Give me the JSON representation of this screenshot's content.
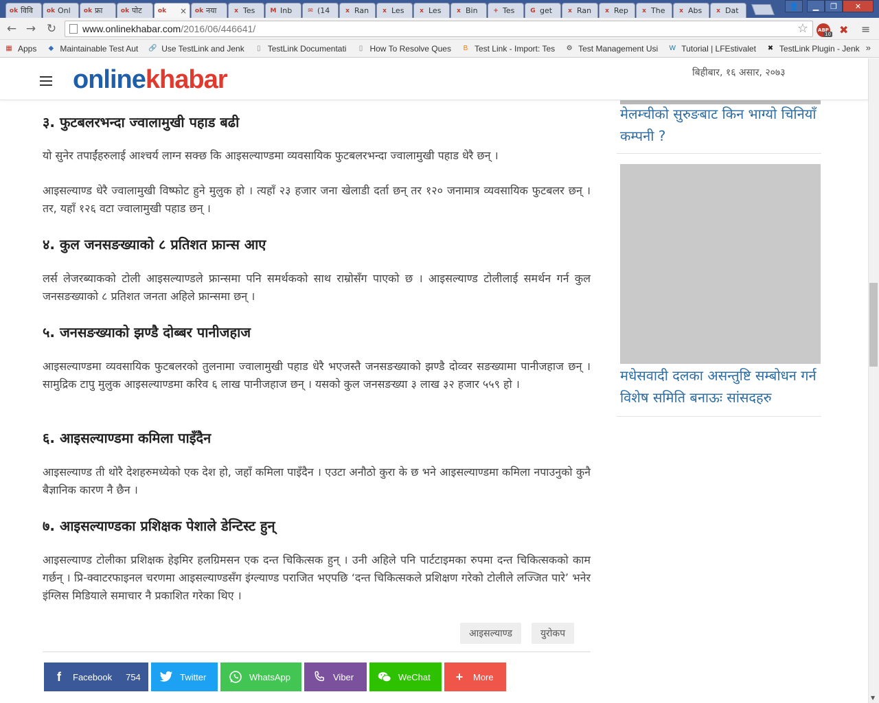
{
  "browser": {
    "tabs": [
      {
        "favicon": "ok",
        "title": "विवि"
      },
      {
        "favicon": "ok",
        "title": "Onl"
      },
      {
        "favicon": "ok",
        "title": "फ्रा"
      },
      {
        "favicon": "ok",
        "title": "पोट"
      },
      {
        "favicon": "ok",
        "title": "",
        "active": true
      },
      {
        "favicon": "ok",
        "title": "नया"
      },
      {
        "favicon": "x",
        "title": "Tes"
      },
      {
        "favicon": "M",
        "title": "Inb"
      },
      {
        "favicon": "✉",
        "title": "(14"
      },
      {
        "favicon": "x",
        "title": "Ran"
      },
      {
        "favicon": "x",
        "title": "Les"
      },
      {
        "favicon": "x",
        "title": "Les"
      },
      {
        "favicon": "x",
        "title": "Bin"
      },
      {
        "favicon": "+",
        "title": "Tes"
      },
      {
        "favicon": "G",
        "title": "get"
      },
      {
        "favicon": "x",
        "title": "Ran"
      },
      {
        "favicon": "x",
        "title": "Rep"
      },
      {
        "favicon": "x",
        "title": "The"
      },
      {
        "favicon": "x",
        "title": "Abs"
      },
      {
        "favicon": "x",
        "title": "Dat"
      }
    ],
    "url_host": "www.onlinekhabar.com",
    "url_path": "/2016/06/446641/",
    "abp_label": "ABP",
    "abp_count": "10",
    "bookmarks": [
      {
        "icon": "apps-grid",
        "label": "Apps"
      },
      {
        "icon": "testlink",
        "label": "Maintainable Test Aut"
      },
      {
        "icon": "link",
        "label": "Use TestLink and Jenk"
      },
      {
        "icon": "page",
        "label": "TestLink Documentati"
      },
      {
        "icon": "page",
        "label": "How To Resolve Ques"
      },
      {
        "icon": "blogger",
        "label": "Test Link - Import: Tes"
      },
      {
        "icon": "tool",
        "label": "Test Management Usi"
      },
      {
        "icon": "wordpress",
        "label": "Tutorial | LFEstivalet"
      },
      {
        "icon": "plugin",
        "label": "TestLink Plugin - Jenk"
      }
    ],
    "bookmarks_more": "»"
  },
  "site": {
    "logo_part1": "online",
    "logo_part2": "khabar",
    "date": "बिहीबार, १६ असार, २०७३"
  },
  "article": {
    "sections": [
      {
        "heading": "३. फुटबलरभन्दा ज्वालामुखी पहाड बढी",
        "paragraphs": [
          "यो सुनेर तपाईंहरुलाई आश्चर्य लाग्न सक्छ कि आइसल्याण्डमा व्यवसायिक फुटबलरभन्दा ज्वालामुखी पहाड धेरै छन् ।",
          "आइसल्याण्ड धेरै ज्वालामुखी विष्फोट हुने मुलुक हो । त्यहाँ २३ हजार जना खेलाडी दर्ता छन् तर १२० जनामात्र व्यवसायिक फुटबलर छन् । तर, यहाँ १२६ वटा ज्वालामुखी पहाड छन् ।"
        ]
      },
      {
        "heading": "४. कुल जनसङख्याको ८ प्रतिशत फ्रान्स आए",
        "paragraphs": [
          "लर्स लेजरब्याकको टोली आइसल्याण्डले फ्रान्समा पनि समर्थकको साथ राम्रोसँग पाएको छ । आइसल्याण्ड टोलीलाई समर्थन गर्न कुल जनसङख्याको ८ प्रतिशत जनता अहिले फ्रान्समा छन् ।"
        ]
      },
      {
        "heading": "५. जनसङख्याको झण्डै दोब्बर पानीजहाज",
        "paragraphs": [
          "आइसल्याण्डमा व्यवसायिक फुटबलरको तुलनामा ज्वालामुखी पहाड धेरै भएजस्तै जनसङख्याको झण्डै दोव्वर सङख्यामा पानीजहाज छन् । सामुद्रिक टापु मुलुक आइसल्याण्डमा करिव ६ लाख पानीजहाज छन् । यसको कुल जनसङख्या ३ लाख ३२ हजार ५५९ हो ।"
        ]
      },
      {
        "heading": "६. आइसल्याण्डमा कमिला पाइँदैन",
        "paragraphs": [
          "आइसल्याण्ड ती थोरै देशहरुमध्येको एक देश हो, जहाँ कमिला पाइँदैन । एउटा अनौठो कुरा के छ भने आइसल्याण्डमा कमिला नपाउनुको कुनै बैज्ञानिक कारण नै छैन ।"
        ]
      },
      {
        "heading": "७. आइसल्याण्डका प्रशिक्षक पेशाले डेन्टिस्ट हुन्",
        "paragraphs": [
          "आइसल्याण्ड टोलीका प्रशिक्षक हेइमिर हलग्रिमसन एक दन्त चिकित्सक हुन् । उनी अहिले पनि पार्टटाइमका रुपमा दन्त चिकित्सकको काम गर्छन् । प्रि-क्वाटरफाइनल चरणमा आइसल्याण्डसँग इंग्ल्याण्ड पराजित भएपछि ‘दन्त चिकित्सकले प्रशिक्षण गरेको टोलीले लज्जित पारे’ भनेर इंग्लिस मिडियाले समाचार नै प्रकाशित गरेका थिए ।"
        ]
      }
    ],
    "tags": [
      "आइसल्याण्ड",
      "युरोकप"
    ]
  },
  "share": {
    "facebook": {
      "label": "Facebook",
      "count": "754",
      "color": "#3b5998"
    },
    "twitter": {
      "label": "Twitter",
      "color": "#1da1f2"
    },
    "whatsapp": {
      "label": "WhatsApp",
      "color": "#43c553"
    },
    "viber": {
      "label": "Viber",
      "color": "#7b519d"
    },
    "wechat": {
      "label": "WeChat",
      "color": "#2dc100"
    },
    "more": {
      "label": "More",
      "color": "#f0554a"
    }
  },
  "sidebar": {
    "link1": "मेलम्चीको सुरुङबाट किन भाग्यो चिनियाँ कम्पनी ?",
    "link2": "मधेसवादी दलका असन्तुष्टि सम्बोधन गर्न विशेष समिति बनाऊः सांसदहरु",
    "link_color": "#2d6da3"
  }
}
